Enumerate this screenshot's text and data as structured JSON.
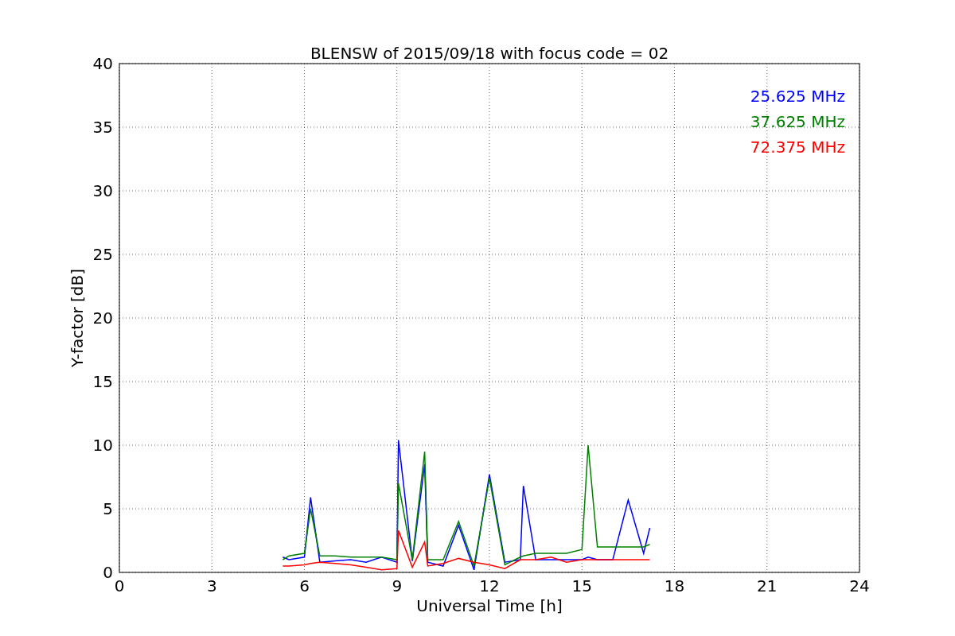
{
  "figure": {
    "chart_data": {
      "type": "line",
      "title": "BLENSW of 2015/09/18 with focus code = 02",
      "xlabel": "Universal Time [h]",
      "ylabel": "Y-factor [dB]",
      "x": [
        5.3,
        5.5,
        6.0,
        6.2,
        6.5,
        7.0,
        7.5,
        8.0,
        8.5,
        9.0,
        9.05,
        9.5,
        9.9,
        10.0,
        10.5,
        11.0,
        11.5,
        12.0,
        12.5,
        13.0,
        13.1,
        13.5,
        14.0,
        14.5,
        15.0,
        15.2,
        15.5,
        16.0,
        16.5,
        17.0,
        17.2
      ],
      "series": [
        {
          "name": "25.625 MHz",
          "color": "#0000ff",
          "values": [
            1.2,
            1.0,
            1.2,
            5.9,
            0.8,
            0.9,
            1.0,
            0.8,
            1.2,
            0.8,
            10.4,
            0.9,
            8.5,
            0.8,
            0.5,
            3.7,
            0.2,
            7.7,
            0.8,
            1.0,
            6.8,
            1.0,
            1.0,
            1.0,
            1.0,
            1.2,
            1.0,
            1.0,
            5.7,
            1.5,
            3.5
          ]
        },
        {
          "name": "37.625 MHz",
          "color": "#008000",
          "values": [
            1.0,
            1.3,
            1.5,
            5.0,
            1.3,
            1.3,
            1.2,
            1.2,
            1.2,
            1.0,
            7.0,
            1.0,
            9.5,
            1.0,
            1.0,
            4.0,
            0.5,
            7.4,
            0.6,
            1.2,
            1.3,
            1.5,
            1.5,
            1.5,
            1.8,
            10.0,
            2.0,
            2.0,
            2.0,
            2.0,
            2.2
          ]
        },
        {
          "name": "72.375 MHz",
          "color": "#ff0000",
          "values": [
            0.5,
            0.5,
            0.6,
            0.7,
            0.8,
            0.7,
            0.6,
            0.4,
            0.2,
            0.3,
            3.3,
            0.4,
            2.4,
            0.5,
            0.7,
            1.1,
            0.8,
            0.6,
            0.3,
            1.0,
            1.0,
            1.0,
            1.2,
            0.8,
            1.0,
            1.0,
            1.0,
            1.0,
            1.0,
            1.0,
            1.0
          ]
        }
      ],
      "grid": true,
      "xlim": [
        0,
        24
      ],
      "ylim": [
        0,
        40
      ],
      "xticks": [
        0,
        3,
        6,
        9,
        12,
        15,
        18,
        21,
        24
      ],
      "yticks": [
        0,
        5,
        10,
        15,
        20,
        25,
        30,
        35,
        40
      ]
    }
  }
}
